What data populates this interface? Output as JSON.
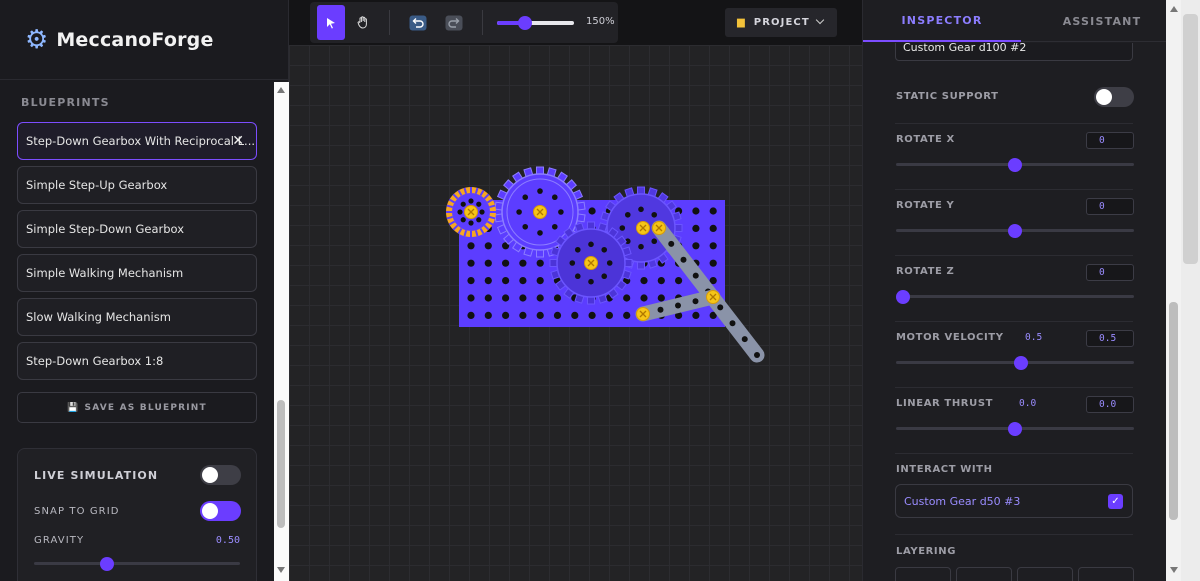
{
  "app": {
    "name": "MeccanoForge",
    "logo_icon": "gear-icon"
  },
  "sidebar": {
    "blueprints_title": "BLUEPRINTS",
    "blueprints": [
      {
        "label": "Step-Down Gearbox With Reciprocal L...",
        "active": true
      },
      {
        "label": "Simple Step-Up Gearbox",
        "active": false
      },
      {
        "label": "Simple Step-Down Gearbox",
        "active": false
      },
      {
        "label": "Simple Walking Mechanism",
        "active": false
      },
      {
        "label": "Slow Walking Mechanism",
        "active": false
      },
      {
        "label": "Step-Down Gearbox 1:8",
        "active": false
      }
    ],
    "remove_glyph": "✕",
    "save_blueprint": {
      "icon": "floppy-disk-icon",
      "label": "SAVE AS BLUEPRINT"
    },
    "simulation": {
      "live_simulation": {
        "label": "LIVE SIMULATION",
        "on": false
      },
      "snap_to_grid": {
        "label": "SNAP TO GRID",
        "on": true
      },
      "gravity": {
        "label": "GRAVITY",
        "value": "0.50",
        "fraction": 0.5
      }
    }
  },
  "toolbar": {
    "tools": [
      {
        "name": "select-tool",
        "icon": "cursor-arrow-icon",
        "active": true
      },
      {
        "name": "pan-tool",
        "icon": "hand-icon",
        "active": false
      },
      {
        "name": "undo",
        "icon": "undo-icon",
        "active": false
      },
      {
        "name": "redo",
        "icon": "redo-icon",
        "active": false
      }
    ],
    "zoom": {
      "label": "150%",
      "fraction": 0.33
    },
    "project": {
      "icon": "folder-icon",
      "label": "PROJECT",
      "chevron": "chevron-down-icon"
    }
  },
  "inspector": {
    "tabs": [
      {
        "label": "INSPECTOR",
        "active": true
      },
      {
        "label": "ASSISTANT",
        "active": false
      }
    ],
    "name_value": "Custom Gear d100 #2",
    "static_support": {
      "label": "STATIC SUPPORT",
      "on": false
    },
    "rotate_x": {
      "label": "ROTATE X",
      "value": "0",
      "fraction": 0.5
    },
    "rotate_y": {
      "label": "ROTATE Y",
      "value": "0",
      "fraction": 0.5
    },
    "rotate_z": {
      "label": "ROTATE Z",
      "value": "0",
      "fraction": 0.0
    },
    "motor_velocity": {
      "label": "MOTOR VELOCITY",
      "readout": "0.5",
      "value": "0.5",
      "fraction": 0.525
    },
    "linear_thrust": {
      "label": "LINEAR THRUST",
      "readout": "0.0",
      "value": "0.0",
      "fraction": 0.5
    },
    "interact_with": {
      "label": "INTERACT WITH",
      "item": "Custom Gear d50 #3",
      "checked": true
    },
    "layering": {
      "label": "LAYERING"
    }
  },
  "colors": {
    "accent": "#6b3dff",
    "gear": "#5c3dff",
    "bolt": "#f5c518",
    "beam": "#8a93a8"
  }
}
